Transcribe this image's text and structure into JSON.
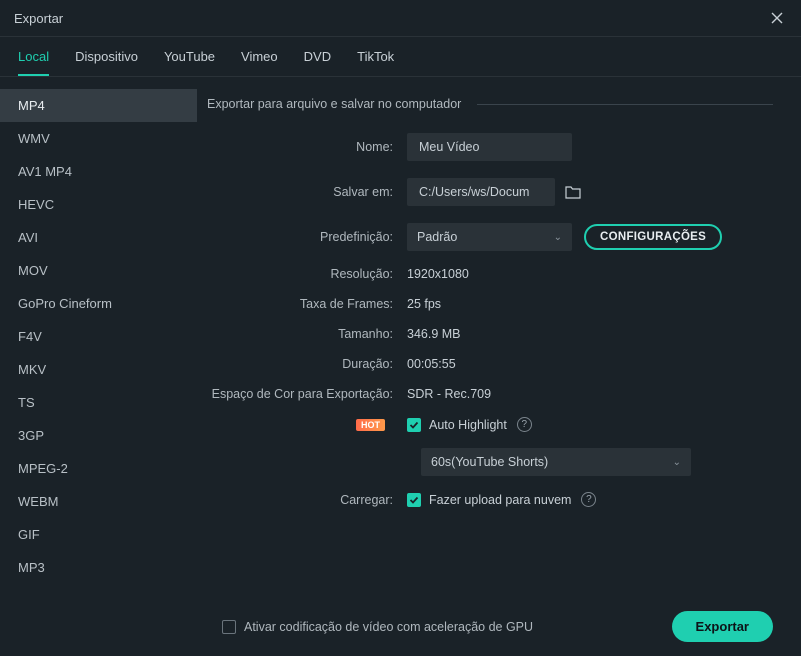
{
  "title": "Exportar",
  "tabs": [
    "Local",
    "Dispositivo",
    "YouTube",
    "Vimeo",
    "DVD",
    "TikTok"
  ],
  "formats": [
    "MP4",
    "WMV",
    "AV1 MP4",
    "HEVC",
    "AVI",
    "MOV",
    "GoPro Cineform",
    "F4V",
    "MKV",
    "TS",
    "3GP",
    "MPEG-2",
    "WEBM",
    "GIF",
    "MP3"
  ],
  "section_header": "Exportar para arquivo e salvar no computador",
  "fields": {
    "name_label": "Nome:",
    "name_value": "Meu Vídeo",
    "save_label": "Salvar em:",
    "save_value": "C:/Users/ws/Docum",
    "preset_label": "Predefinição:",
    "preset_value": "Padrão",
    "config_btn": "CONFIGURAÇÕES",
    "resolution_label": "Resolução:",
    "resolution_value": "1920x1080",
    "framerate_label": "Taxa de Frames:",
    "framerate_value": "25 fps",
    "size_label": "Tamanho:",
    "size_value": "346.9 MB",
    "duration_label": "Duração:",
    "duration_value": "00:05:55",
    "colorspace_label": "Espaço de Cor para Exportação:",
    "colorspace_value": "SDR - Rec.709",
    "hot_badge": "HOT",
    "autohighlight_label": "Auto Highlight",
    "shorts_value": "60s(YouTube Shorts)",
    "upload_label": "Carregar:",
    "upload_text": "Fazer upload para nuvem"
  },
  "footer": {
    "gpu_label": "Ativar codificação de vídeo com aceleração de GPU",
    "export_btn": "Exportar"
  }
}
